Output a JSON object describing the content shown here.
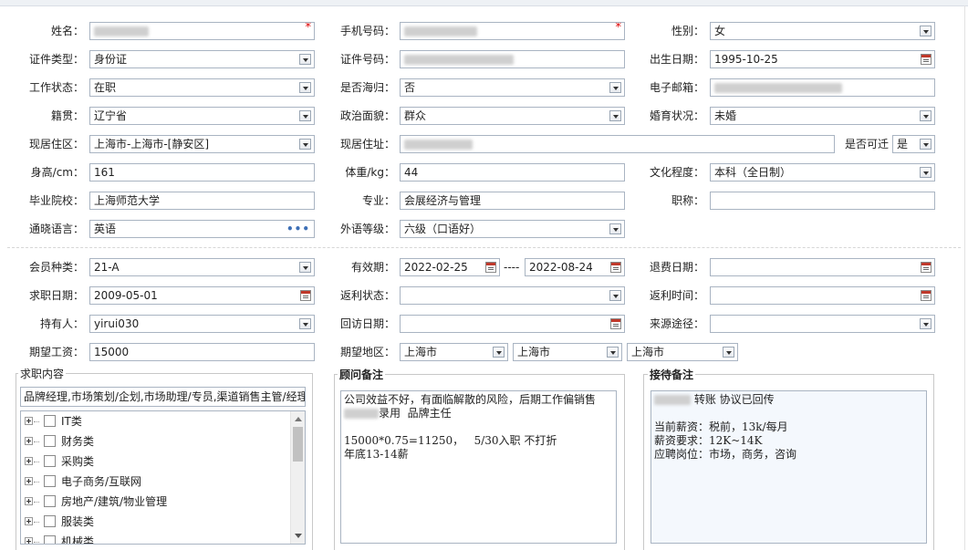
{
  "personal": {
    "name_label": "姓名：",
    "phone_label": "手机号码：",
    "gender_label": "性别：",
    "gender_value": "女",
    "id_type_label": "证件类型：",
    "id_type_value": "身份证",
    "id_no_label": "证件号码：",
    "birth_label": "出生日期：",
    "birth_value": "1995-10-25",
    "work_status_label": "工作状态：",
    "work_status_value": "在职",
    "returnee_label": "是否海归：",
    "returnee_value": "否",
    "email_label": "电子邮箱：",
    "native_label": "籍贯：",
    "native_value": "辽宁省",
    "political_label": "政治面貌：",
    "political_value": "群众",
    "marital_label": "婚育状况：",
    "marital_value": "未婚",
    "current_area_label": "现居住区：",
    "current_area_value": "上海市-上海市-[静安区]",
    "address_label": "现居住址：",
    "relocate_label": "是否可迁",
    "relocate_value": "是",
    "height_label": "身高/cm：",
    "height_value": "161",
    "weight_label": "体重/kg：",
    "weight_value": "44",
    "education_label": "文化程度：",
    "education_value": "本科（全日制）",
    "school_label": "毕业院校：",
    "school_value": "上海师范大学",
    "major_label": "专业：",
    "major_value": "会展经济与管理",
    "title_label": "职称：",
    "title_value": "",
    "language_label": "通晓语言：",
    "language_value": "英语",
    "language_more": "•••",
    "foreign_level_label": "外语等级：",
    "foreign_level_value": "六级（口语好）",
    "required_mark": "*"
  },
  "membership": {
    "member_type_label": "会员种类：",
    "member_type_value": "21-A",
    "valid_label": "有效期：",
    "valid_from": "2022-02-25",
    "valid_sep": "----",
    "valid_to": "2022-08-24",
    "refund_date_label": "退费日期：",
    "refund_date_value": "",
    "job_date_label": "求职日期：",
    "job_date_value": "2009-05-01",
    "rebate_status_label": "返利状态：",
    "rebate_status_value": "",
    "rebate_time_label": "返利时间：",
    "rebate_time_value": "",
    "holder_label": "持有人：",
    "holder_value": "yirui030",
    "visit_date_label": "回访日期：",
    "visit_date_value": "",
    "source_label": "来源途径：",
    "source_value": "",
    "salary_label": "期望工资：",
    "salary_value": "15000",
    "region_label": "期望地区：",
    "region_province": "上海市",
    "region_city": "上海市",
    "region_district": "上海市"
  },
  "job_content": {
    "title": "求职内容",
    "selected_text": "品牌经理,市场策划/企划,市场助理/专员,渠道销售主管/经理",
    "categories": [
      "IT类",
      "财务类",
      "采购类",
      "电子商务/互联网",
      "房地产/建筑/物业管理",
      "服装类",
      "机械类"
    ]
  },
  "consultant_note": {
    "title": "顾问备注",
    "line1": "公司效益不好，有面临解散的风险，后期工作偏销售",
    "line2_suffix": "录用  品牌主任",
    "line3": "",
    "line4": "15000*0.75=11250，   5/30入职 不打折",
    "line5": "年底13-14薪"
  },
  "reception_note": {
    "title": "接待备注",
    "line1_suffix": " 转账 协议已回传",
    "line2": "",
    "line3": "当前薪资：税前，13k/每月",
    "line4": "薪资要求：12K~14K",
    "line5": "应聘岗位：市场，商务，咨询"
  }
}
